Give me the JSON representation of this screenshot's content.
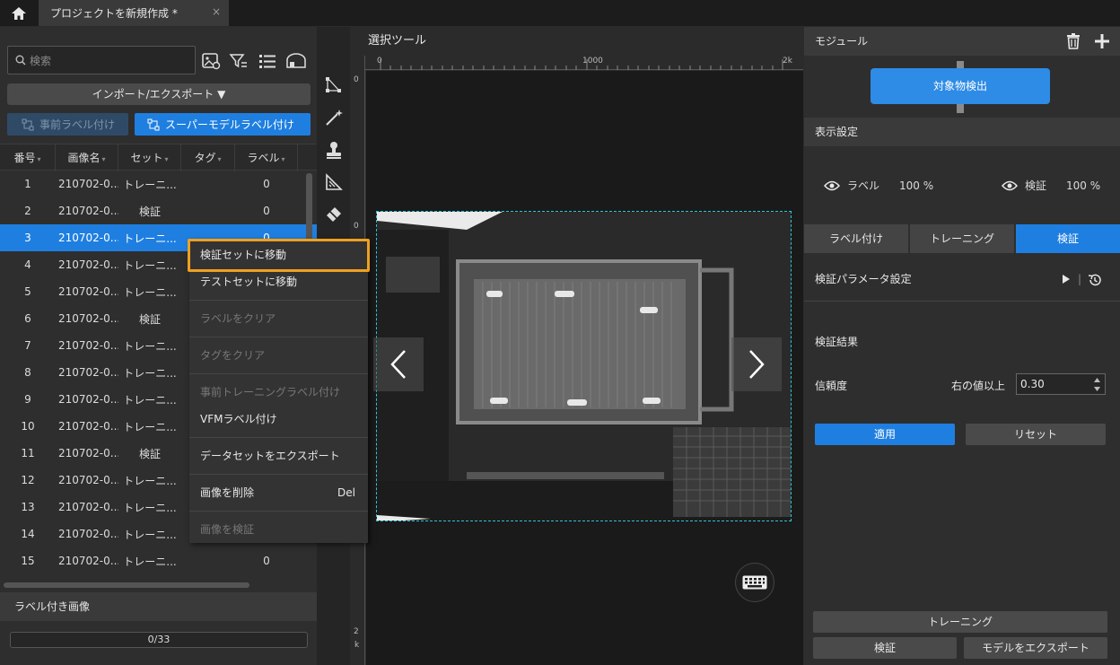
{
  "titlebar": {
    "tab_title": "プロジェクトを新規作成 *",
    "close_glyph": "×"
  },
  "left": {
    "search_placeholder": "検索",
    "import_export_label": "インポート/エクスポート ▼",
    "pre_label_button": "事前ラベル付け",
    "super_model_button": "スーパーモデルラベル付け",
    "columns": [
      "番号",
      "画像名",
      "セット",
      "タグ",
      "ラベル"
    ],
    "rows": [
      {
        "num": "1",
        "name": "210702-0...",
        "set": "トレーニ...",
        "tag": "",
        "label": "0"
      },
      {
        "num": "2",
        "name": "210702-0...",
        "set": "検証",
        "tag": "",
        "label": "0"
      },
      {
        "num": "3",
        "name": "210702-0...",
        "set": "トレーニ...",
        "tag": "",
        "label": "0"
      },
      {
        "num": "4",
        "name": "210702-0...",
        "set": "トレーニ...",
        "tag": "",
        "label": ""
      },
      {
        "num": "5",
        "name": "210702-0...",
        "set": "トレーニ...",
        "tag": "",
        "label": ""
      },
      {
        "num": "6",
        "name": "210702-0...",
        "set": "検証",
        "tag": "",
        "label": ""
      },
      {
        "num": "7",
        "name": "210702-0...",
        "set": "トレーニ...",
        "tag": "",
        "label": ""
      },
      {
        "num": "8",
        "name": "210702-0...",
        "set": "トレーニ...",
        "tag": "",
        "label": ""
      },
      {
        "num": "9",
        "name": "210702-0...",
        "set": "トレーニ...",
        "tag": "",
        "label": ""
      },
      {
        "num": "10",
        "name": "210702-0...",
        "set": "トレーニ...",
        "tag": "",
        "label": ""
      },
      {
        "num": "11",
        "name": "210702-0...",
        "set": "検証",
        "tag": "",
        "label": ""
      },
      {
        "num": "12",
        "name": "210702-0...",
        "set": "トレーニ...",
        "tag": "",
        "label": ""
      },
      {
        "num": "13",
        "name": "210702-0...",
        "set": "トレーニ...",
        "tag": "",
        "label": ""
      },
      {
        "num": "14",
        "name": "210702-0...",
        "set": "トレーニ...",
        "tag": "",
        "label": ""
      },
      {
        "num": "15",
        "name": "210702-0...",
        "set": "トレーニ...",
        "tag": "",
        "label": "0"
      }
    ],
    "selected_row": 3,
    "labeled_images_header": "ラベル付き画像",
    "labeled_progress": "0/33"
  },
  "context_menu": {
    "items": [
      {
        "label": "検証セットに移動",
        "shortcut": "",
        "disabled": false
      },
      {
        "label": "テストセットに移動",
        "shortcut": "",
        "disabled": false
      },
      {
        "label": "ラベルをクリア",
        "shortcut": "",
        "disabled": true
      },
      {
        "label": "タグをクリア",
        "shortcut": "",
        "disabled": true
      },
      {
        "label": "事前トレーニングラベル付け",
        "shortcut": "",
        "disabled": true
      },
      {
        "label": "VFMラベル付け",
        "shortcut": "",
        "disabled": false
      },
      {
        "label": "データセットをエクスポート",
        "shortcut": "",
        "disabled": false
      },
      {
        "label": "画像を削除",
        "shortcut": "Del",
        "disabled": false
      },
      {
        "label": "画像を検証",
        "shortcut": "",
        "disabled": true
      }
    ]
  },
  "canvas": {
    "header": "選択ツール",
    "ruler_top": [
      "0",
      "1000",
      "2k"
    ],
    "ruler_left": [
      "0",
      "0",
      "2",
      "k"
    ]
  },
  "right": {
    "module_header": "モジュール",
    "module_node": "対象物検出",
    "display_header": "表示設定",
    "label_vis": {
      "name": "ラベル",
      "value": "100 %"
    },
    "verify_vis": {
      "name": "検証",
      "value": "100 %"
    },
    "tabs": [
      "ラベル付け",
      "トレーニング",
      "検証"
    ],
    "active_tab": 2,
    "param_label": "検証パラメータ設定",
    "result_label": "検証結果",
    "confidence_label": "信頼度",
    "above_label": "右の値以上",
    "confidence_value": "0.30",
    "apply_label": "適用",
    "reset_label": "リセット",
    "train_button": "トレーニング",
    "verify_button": "検証",
    "export_button": "モデルをエクスポート"
  },
  "colors": {
    "accent": "#1f7fe0",
    "highlight": "#f0a020",
    "selection_box": "#2ec4d6"
  }
}
